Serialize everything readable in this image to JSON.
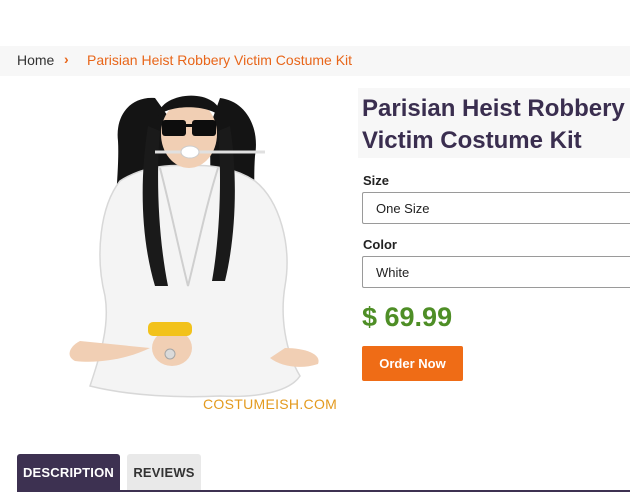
{
  "breadcrumb": {
    "home": "Home",
    "separator": "›",
    "current": "Parisian Heist Robbery Victim Costume Kit"
  },
  "product": {
    "title": "Parisian Heist Robbery Victim Costume Kit",
    "watermark": "COSTUMEISH.COM",
    "size_label": "Size",
    "size_value": "One Size",
    "color_label": "Color",
    "color_value": "White",
    "price": "$ 69.99",
    "order_label": "Order Now"
  },
  "tabs": [
    {
      "label": "DESCRIPTION",
      "active": true
    },
    {
      "label": "REVIEWS",
      "active": false
    }
  ],
  "colors": {
    "accent_orange": "#ef6c16",
    "title_purple": "#3a2e4f",
    "price_green": "#4e8e26",
    "tab_active": "#3d3151"
  }
}
